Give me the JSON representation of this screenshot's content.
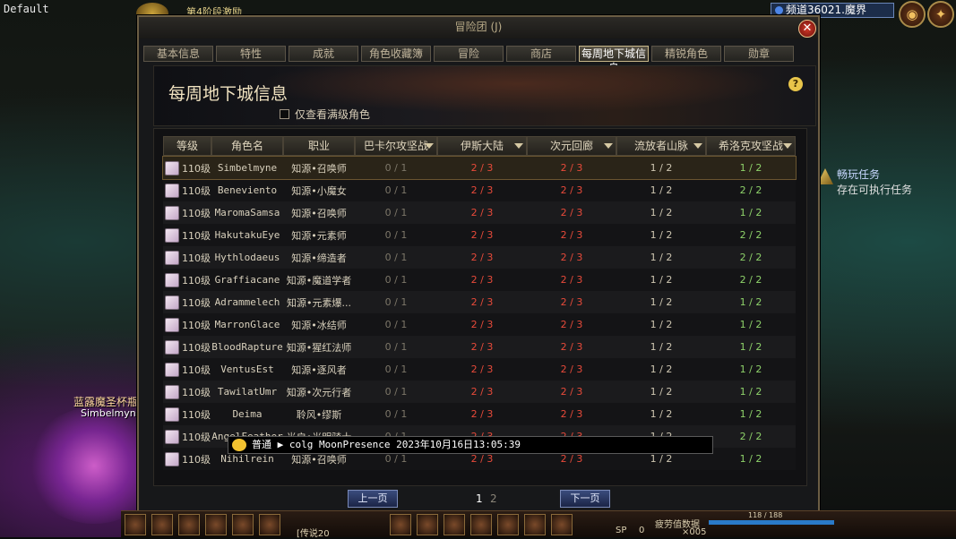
{
  "top_bar": {
    "left_label": "Default",
    "stage": "第4阶段激励",
    "channel": "频道36021.魔界"
  },
  "window": {
    "title": "冒险团 (J)",
    "tabs": [
      "基本信息",
      "特性",
      "成就",
      "角色收藏簿",
      "冒险",
      "商店",
      "每周地下城信息",
      "精锐角色",
      "勋章"
    ],
    "active_tab": "每周地下城信息",
    "banner_title": "每周地下城信息",
    "filter_label": "仅查看满级角色"
  },
  "table": {
    "headers": [
      "等级",
      "角色名",
      "职业",
      "巴卡尔攻坚战",
      "伊斯大陆",
      "次元回廊",
      "流放者山脉",
      "希洛克攻坚战"
    ],
    "rows": [
      {
        "level": "110级",
        "name": "Simbelmyne",
        "job": "知源•召唤师",
        "d1": "0 / 1",
        "d2": "2 / 3",
        "d3": "2 / 3",
        "d4": "1 / 2",
        "d5": "1 / 2"
      },
      {
        "level": "110级",
        "name": "Beneviento",
        "job": "知源•小魔女",
        "d1": "0 / 1",
        "d2": "2 / 3",
        "d3": "2 / 3",
        "d4": "1 / 2",
        "d5": "2 / 2"
      },
      {
        "level": "110级",
        "name": "MaromaSamsa",
        "job": "知源•召唤师",
        "d1": "0 / 1",
        "d2": "2 / 3",
        "d3": "2 / 3",
        "d4": "1 / 2",
        "d5": "1 / 2"
      },
      {
        "level": "110级",
        "name": "HakutakuEye",
        "job": "知源•元素师",
        "d1": "0 / 1",
        "d2": "2 / 3",
        "d3": "2 / 3",
        "d4": "1 / 2",
        "d5": "2 / 2"
      },
      {
        "level": "110级",
        "name": "Hythlodaeus",
        "job": "知源•缔造者",
        "d1": "0 / 1",
        "d2": "2 / 3",
        "d3": "2 / 3",
        "d4": "1 / 2",
        "d5": "2 / 2"
      },
      {
        "level": "110级",
        "name": "Graffiacane",
        "job": "知源•魔道学者",
        "d1": "0 / 1",
        "d2": "2 / 3",
        "d3": "2 / 3",
        "d4": "1 / 2",
        "d5": "2 / 2"
      },
      {
        "level": "110级",
        "name": "Adrammelech",
        "job": "知源•元素爆...",
        "d1": "0 / 1",
        "d2": "2 / 3",
        "d3": "2 / 3",
        "d4": "1 / 2",
        "d5": "1 / 2"
      },
      {
        "level": "110级",
        "name": "MarronGlace",
        "job": "知源•冰结师",
        "d1": "0 / 1",
        "d2": "2 / 3",
        "d3": "2 / 3",
        "d4": "1 / 2",
        "d5": "1 / 2"
      },
      {
        "level": "110级",
        "name": "BloodRapture",
        "job": "知源•猩红法师",
        "d1": "0 / 1",
        "d2": "2 / 3",
        "d3": "2 / 3",
        "d4": "1 / 2",
        "d5": "1 / 2"
      },
      {
        "level": "110级",
        "name": "VentusEst",
        "job": "知源•逐风者",
        "d1": "0 / 1",
        "d2": "2 / 3",
        "d3": "2 / 3",
        "d4": "1 / 2",
        "d5": "1 / 2"
      },
      {
        "level": "110级",
        "name": "TawilatUmr",
        "job": "知源•次元行者",
        "d1": "0 / 1",
        "d2": "2 / 3",
        "d3": "2 / 3",
        "d4": "1 / 2",
        "d5": "1 / 2"
      },
      {
        "level": "110级",
        "name": "Deima",
        "job": "聆风•缪斯",
        "d1": "0 / 1",
        "d2": "2 / 3",
        "d3": "2 / 3",
        "d4": "1 / 2",
        "d5": "1 / 2"
      },
      {
        "level": "110级",
        "name": "AngelFeather",
        "job": "光启•光明骑士",
        "d1": "0 / 1",
        "d2": "2 / 3",
        "d3": "2 / 3",
        "d4": "1 / 2",
        "d5": "2 / 2"
      },
      {
        "level": "110级",
        "name": "Nihilrein",
        "job": "知源•召唤师",
        "d1": "0 / 1",
        "d2": "2 / 3",
        "d3": "2 / 3",
        "d4": "1 / 2",
        "d5": "1 / 2"
      }
    ]
  },
  "pager": {
    "prev": "上一页",
    "next": "下一页",
    "pages": [
      "1",
      "2"
    ]
  },
  "chat": {
    "channel_label": "普通",
    "message": "colg MoonPresence 2023年10月16日13:05:39"
  },
  "quest": {
    "title": "畅玩任务",
    "desc": "存在可执行任务"
  },
  "character": {
    "title": "蓝露魔圣杯瓶",
    "name": "Simbelmyne"
  },
  "hud": {
    "level_text": "[传说20",
    "sp_label": "SP",
    "sp_value": "0",
    "fatigue_label": "疲劳值数据",
    "fatigue_value": "118 / 188",
    "count": "×005"
  }
}
